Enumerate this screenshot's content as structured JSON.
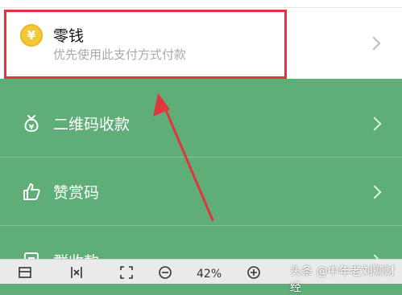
{
  "wallet": {
    "title": "零钱",
    "subtitle": "优先使用此支付方式付款",
    "coin_symbol": "¥"
  },
  "rows": [
    {
      "label": "二维码收款",
      "icon": "money-bag-icon"
    },
    {
      "label": "赞赏码",
      "icon": "thumbs-up-icon"
    },
    {
      "label": "群收款",
      "icon": "group-collect-icon"
    }
  ],
  "toolbar": {
    "zoom": "42%",
    "watermark": "头条 @中年老刘聊财经"
  },
  "colors": {
    "accent_green": "#5fae78",
    "highlight_red": "#e0363f",
    "coin_gold": "#f3c836"
  }
}
